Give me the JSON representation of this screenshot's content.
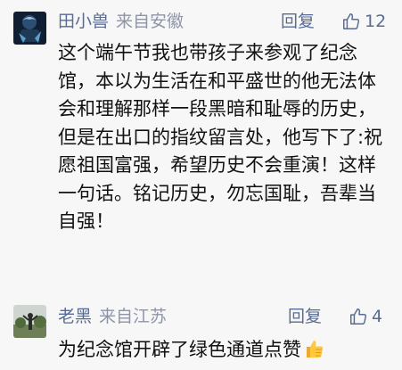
{
  "comments": [
    {
      "author": "田小兽",
      "source": "来自安徽",
      "reply_label": "回复",
      "likes": "12",
      "text": "这个端午节我也带孩子来参观了纪念馆，本以为生活在和平盛世的他无法体会和理解那样一段黑暗和耻辱的历史，但是在出口的指纹留言处，他写下了:祝愿祖国富强，希望历史不会重演！这样一句话。铭记历史，勿忘国耻，吾辈当自强！"
    },
    {
      "author": "老黑",
      "source": "来自江苏",
      "reply_label": "回复",
      "likes": "4",
      "text": "为纪念馆开辟了绿色通道点赞",
      "emoji": "thumbs-up-emoji"
    }
  ],
  "colors": {
    "link": "#586b95",
    "meta": "#8d95a7",
    "background": "#f7f7f7"
  }
}
